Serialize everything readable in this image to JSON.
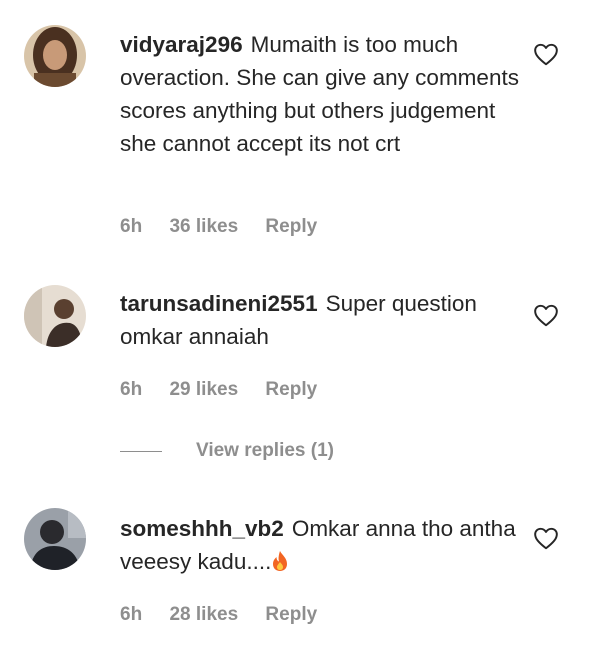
{
  "comments": [
    {
      "username": "vidyaraj296",
      "text": "Mumaith is too much overaction. She can give any comments scores anything but others judgement she cannot accept its not crt",
      "time": "6h",
      "likes": "36 likes",
      "reply": "Reply",
      "avatar_color": "#7a5a3a"
    },
    {
      "username": "tarunsadineni2551",
      "text": "Super question omkar annaiah",
      "time": "6h",
      "likes": "29 likes",
      "reply": "Reply",
      "avatar_color": "#8a7a6a"
    },
    {
      "username": "someshhh_vb2",
      "text": "Omkar anna tho antha veeesy kadu....",
      "emoji": "fire",
      "time": "6h",
      "likes": "28 likes",
      "reply": "Reply",
      "avatar_color": "#3a3f48"
    }
  ],
  "view_replies": "View replies (1)",
  "colors": {
    "text": "#262626",
    "meta": "#8e8e8e",
    "fire": "#f26522"
  },
  "icons": [
    "heart-icon",
    "fire-icon"
  ]
}
